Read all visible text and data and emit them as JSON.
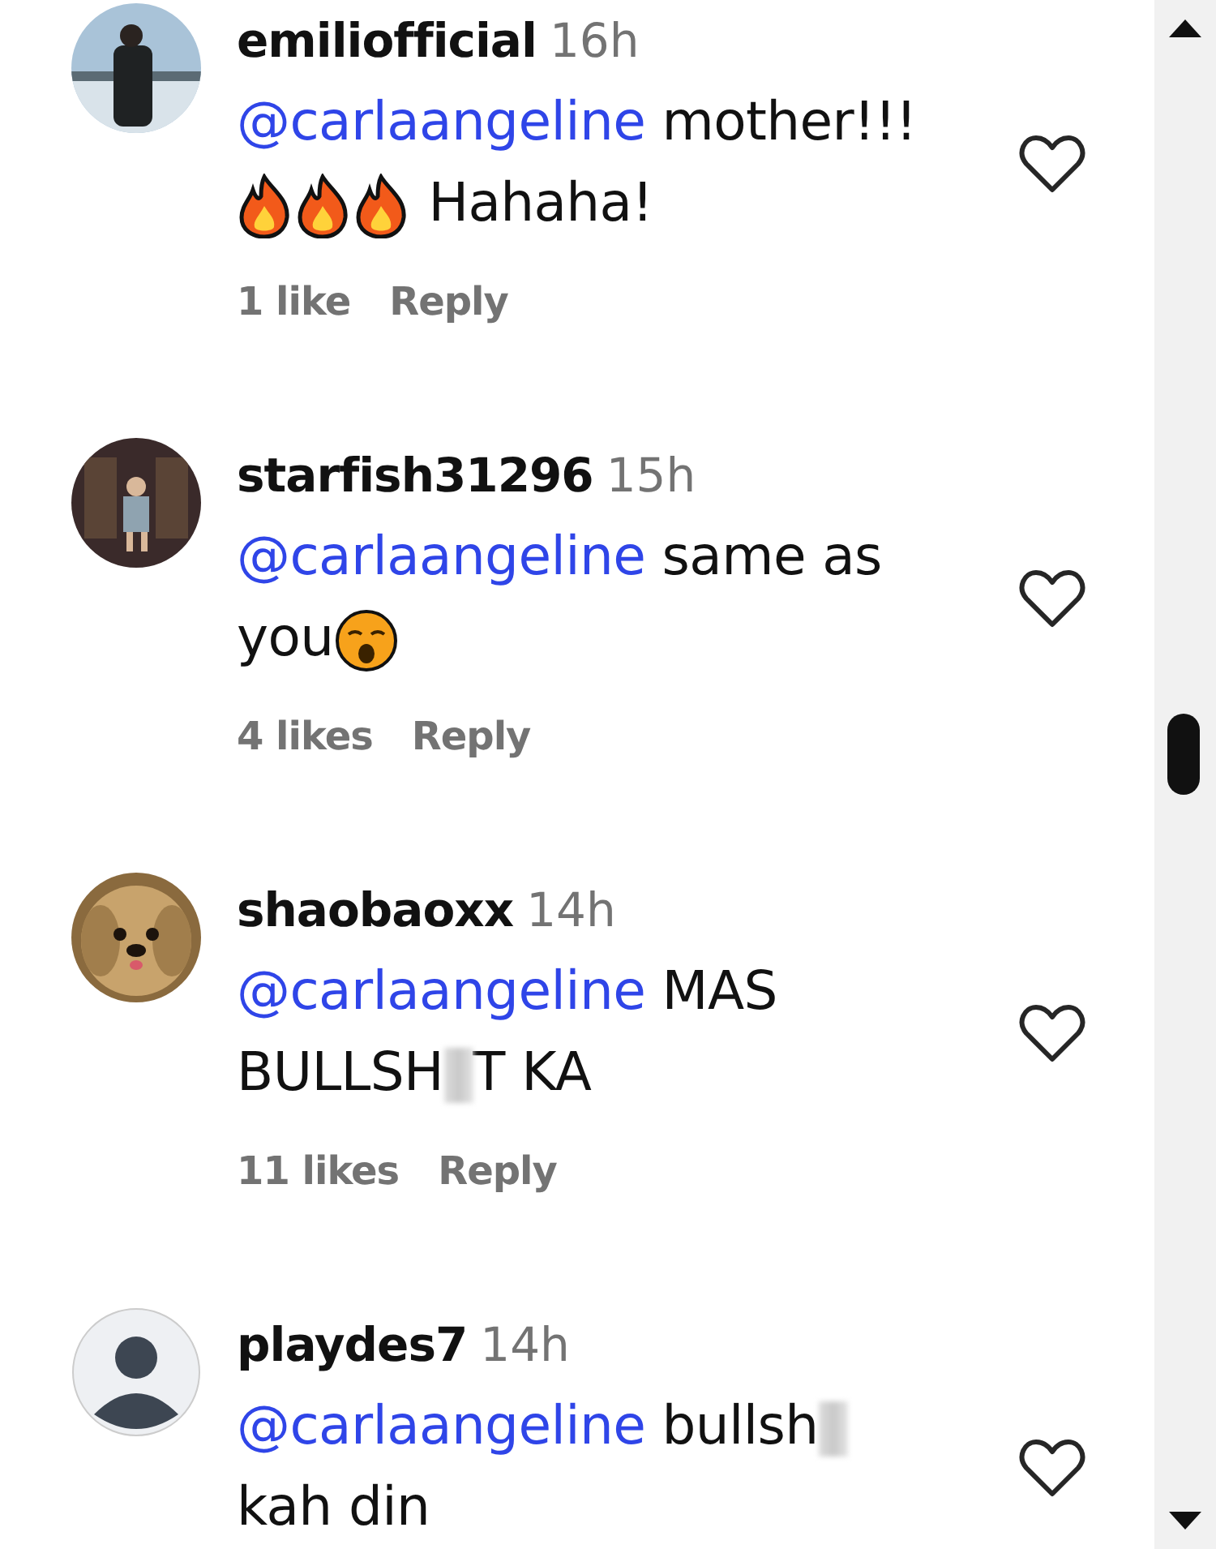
{
  "comments": [
    {
      "avatar": {
        "kind": "picture"
      },
      "username": "emiliofficial",
      "time": "16h",
      "mention": "@carlaangeline",
      "segments": [
        {
          "kind": "text",
          "text": "mother!!!"
        },
        {
          "kind": "break"
        },
        {
          "kind": "fire"
        },
        {
          "kind": "fire"
        },
        {
          "kind": "fire"
        },
        {
          "kind": "text",
          "text": " Hahaha!"
        }
      ],
      "likes": "1 like",
      "reply": "Reply",
      "liked": false
    },
    {
      "avatar": {
        "kind": "picture"
      },
      "username": "starfish31296",
      "time": "15h",
      "mention": "@carlaangeline",
      "segments": [
        {
          "kind": "text",
          "text": "same as"
        },
        {
          "kind": "break"
        },
        {
          "kind": "text",
          "text": "you"
        },
        {
          "kind": "kiss"
        }
      ],
      "likes": "4 likes",
      "reply": "Reply",
      "liked": false
    },
    {
      "avatar": {
        "kind": "picture"
      },
      "username": "shaobaoxx",
      "time": "14h",
      "mention": "@carlaangeline",
      "segments": [
        {
          "kind": "text",
          "text": "MAS"
        },
        {
          "kind": "break"
        },
        {
          "kind": "text",
          "text": "BULLSH"
        },
        {
          "kind": "censor"
        },
        {
          "kind": "text",
          "text": "T KA"
        }
      ],
      "likes": "11 likes",
      "reply": "Reply",
      "liked": false
    },
    {
      "avatar": {
        "kind": "placeholder"
      },
      "username": "playdes7",
      "time": "14h",
      "mention": "@carlaangeline",
      "segments": [
        {
          "kind": "text",
          "text": "bullsh"
        },
        {
          "kind": "censor"
        },
        {
          "kind": "break"
        },
        {
          "kind": "text",
          "text": "kah din"
        }
      ],
      "liked": false
    }
  ]
}
